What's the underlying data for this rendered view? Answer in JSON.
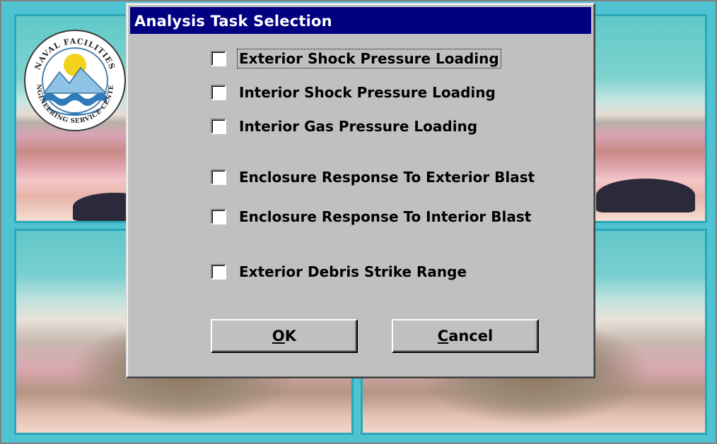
{
  "window": {
    "title": "Analysis Task Selection"
  },
  "options": [
    {
      "label": "Exterior Shock Pressure Loading",
      "checked": false,
      "focused": true
    },
    {
      "label": "Interior Shock Pressure Loading",
      "checked": false,
      "focused": false
    },
    {
      "label": "Interior Gas Pressure Loading",
      "checked": false,
      "focused": false
    },
    {
      "label": "Enclosure Response To Exterior Blast",
      "checked": false,
      "focused": false
    },
    {
      "label": "Enclosure Response To Interior Blast",
      "checked": false,
      "focused": false
    },
    {
      "label": "Exterior Debris Strike Range",
      "checked": false,
      "focused": false
    }
  ],
  "buttons": {
    "ok": {
      "mnemonic": "O",
      "rest": "K"
    },
    "cancel": {
      "mnemonic": "C",
      "rest": "ancel"
    }
  },
  "logo": {
    "icon": "naval-facilities-engineering-service-center-seal-icon",
    "text": "NAVAL FACILITIES ENGINEERING SERVICE CENTER"
  },
  "colors": {
    "titlebar": "#000080",
    "dialog_face": "#c0c0c0",
    "backdrop_frame": "#2aa7b8"
  }
}
